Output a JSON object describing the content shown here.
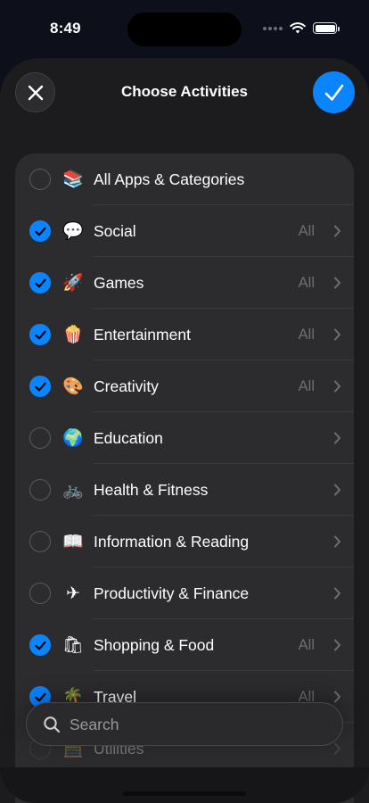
{
  "status": {
    "time": "8:49"
  },
  "header": {
    "title": "Choose Activities",
    "close_icon": "close-icon",
    "confirm_icon": "checkmark-icon"
  },
  "colors": {
    "accent": "#0a84ff",
    "sheet": "#1c1c1e",
    "list": "#2c2c2e",
    "secondary_text": "#6e6e73"
  },
  "list": {
    "items": [
      {
        "label": "All Apps & Categories",
        "emoji": "📚",
        "icon": "stack-icon",
        "checked": false,
        "detail": "",
        "chevron": false
      },
      {
        "label": "Social",
        "emoji": "💬",
        "icon": "speech-bubble-heart-icon",
        "checked": true,
        "detail": "All",
        "chevron": true
      },
      {
        "label": "Games",
        "emoji": "🚀",
        "icon": "rocket-icon",
        "checked": true,
        "detail": "All",
        "chevron": true
      },
      {
        "label": "Entertainment",
        "emoji": "🍿",
        "icon": "popcorn-icon",
        "checked": true,
        "detail": "All",
        "chevron": true
      },
      {
        "label": "Creativity",
        "emoji": "🎨",
        "icon": "palette-icon",
        "checked": true,
        "detail": "All",
        "chevron": true
      },
      {
        "label": "Education",
        "emoji": "🌍",
        "icon": "globe-icon",
        "checked": false,
        "detail": "",
        "chevron": true
      },
      {
        "label": "Health & Fitness",
        "emoji": "🚲",
        "icon": "bicycle-icon",
        "checked": false,
        "detail": "",
        "chevron": true
      },
      {
        "label": "Information & Reading",
        "emoji": "📖",
        "icon": "book-icon",
        "checked": false,
        "detail": "",
        "chevron": true
      },
      {
        "label": "Productivity & Finance",
        "emoji": "✈",
        "icon": "paper-plane-icon",
        "checked": false,
        "detail": "",
        "chevron": true
      },
      {
        "label": "Shopping & Food",
        "emoji": "🛍",
        "icon": "shopping-bag-icon",
        "checked": true,
        "detail": "All",
        "chevron": true
      },
      {
        "label": "Travel",
        "emoji": "🌴",
        "icon": "palm-tree-icon",
        "checked": true,
        "detail": "All",
        "chevron": true
      },
      {
        "label": "Utilities",
        "emoji": "🧮",
        "icon": "calculator-icon",
        "checked": false,
        "detail": "",
        "chevron": true
      }
    ]
  },
  "search": {
    "placeholder": "Search",
    "value": "",
    "icon": "search-icon"
  }
}
